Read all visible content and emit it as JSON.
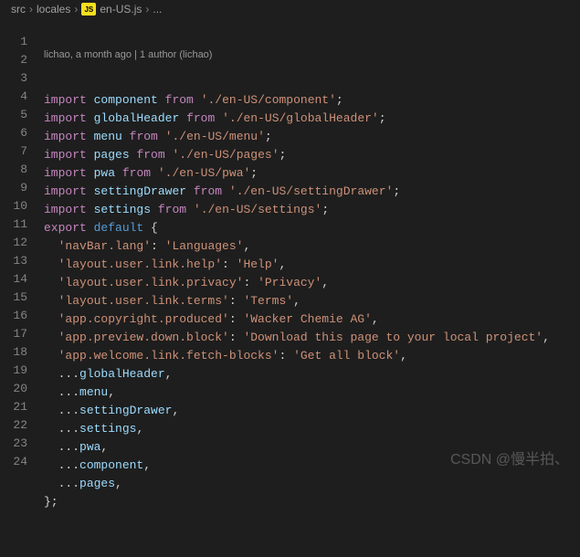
{
  "breadcrumb": {
    "seg1": "src",
    "seg2": "locales",
    "file_icon": "JS",
    "file": "en-US.js",
    "tail": "..."
  },
  "codelens": "lichao, a month ago | 1 author (lichao)",
  "code": {
    "imports": [
      {
        "name": "component",
        "path": "'./en-US/component'"
      },
      {
        "name": "globalHeader",
        "path": "'./en-US/globalHeader'"
      },
      {
        "name": "menu",
        "path": "'./en-US/menu'"
      },
      {
        "name": "pages",
        "path": "'./en-US/pages'"
      },
      {
        "name": "pwa",
        "path": "'./en-US/pwa'"
      },
      {
        "name": "settingDrawer",
        "path": "'./en-US/settingDrawer'"
      },
      {
        "name": "settings",
        "path": "'./en-US/settings'"
      }
    ],
    "export_open": "{",
    "entries": [
      {
        "key": "'navBar.lang'",
        "val": "'Languages'"
      },
      {
        "key": "'layout.user.link.help'",
        "val": "'Help'"
      },
      {
        "key": "'layout.user.link.privacy'",
        "val": "'Privacy'"
      },
      {
        "key": "'layout.user.link.terms'",
        "val": "'Terms'"
      },
      {
        "key": "'app.copyright.produced'",
        "val": "'Wacker Chemie AG'"
      },
      {
        "key": "'app.preview.down.block'",
        "val": "'Download this page to your local project'"
      },
      {
        "key": "'app.welcome.link.fetch-blocks'",
        "val": "'Get all block'"
      }
    ],
    "spreads": [
      "globalHeader",
      "menu",
      "settingDrawer",
      "settings",
      "pwa",
      "component",
      "pages"
    ],
    "close": "};"
  },
  "line_numbers": [
    "1",
    "2",
    "3",
    "4",
    "5",
    "6",
    "7",
    "8",
    "9",
    "10",
    "11",
    "12",
    "13",
    "14",
    "15",
    "16",
    "17",
    "18",
    "19",
    "20",
    "21",
    "22",
    "23",
    "24"
  ],
  "watermark": "CSDN @慢半拍、"
}
